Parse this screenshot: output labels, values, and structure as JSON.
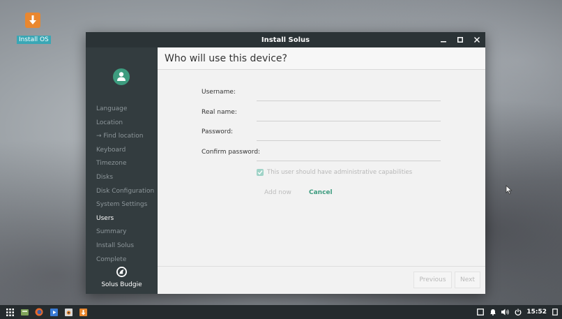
{
  "desktop": {
    "icon_label": "Install OS"
  },
  "window": {
    "title": "Install Solus",
    "controls": [
      "minimize-icon",
      "maximize-icon",
      "close-icon"
    ]
  },
  "sidebar": {
    "items": [
      {
        "label": "Language"
      },
      {
        "label": "Location"
      },
      {
        "label": "→ Find location"
      },
      {
        "label": "Keyboard"
      },
      {
        "label": "Timezone"
      },
      {
        "label": "Disks"
      },
      {
        "label": "Disk Configuration"
      },
      {
        "label": "System Settings"
      },
      {
        "label": "Users"
      },
      {
        "label": "Summary"
      },
      {
        "label": "Install Solus"
      },
      {
        "label": "Complete"
      }
    ],
    "active_index": 8,
    "brand": "Solus Budgie"
  },
  "page": {
    "heading": "Who will use this device?",
    "fields": [
      {
        "label": "Username:",
        "value": ""
      },
      {
        "label": "Real name:",
        "value": ""
      },
      {
        "label": "Password:",
        "value": ""
      },
      {
        "label": "Confirm password:",
        "value": ""
      }
    ],
    "admin_label": "This user should have administrative capabilities",
    "admin_checked": true,
    "add_now": "Add now",
    "cancel": "Cancel"
  },
  "footer": {
    "previous": "Previous",
    "next": "Next"
  },
  "taskbar": {
    "apps": [
      "app-grid-icon",
      "file-manager-icon",
      "firefox-icon",
      "video-player-icon",
      "camera-icon",
      "installer-icon"
    ],
    "clock": "15:52"
  },
  "colors": {
    "accent": "#3d9c7f",
    "sidebar_bg": "#333c3f",
    "titlebar_bg": "#2b3336",
    "taskbar_bg": "#252b2e",
    "installer_orange": "#e9872f"
  }
}
